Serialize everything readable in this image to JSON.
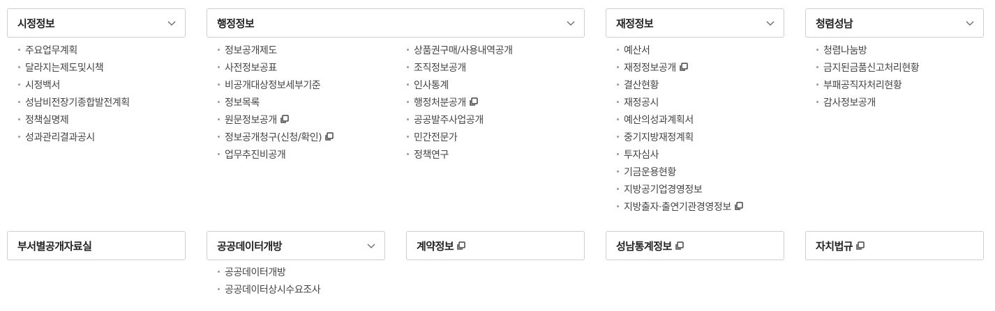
{
  "menus": {
    "city": {
      "title": "시정정보",
      "items": [
        "주요업무계획",
        "달라지는제도및시책",
        "시정백서",
        "성남비전장기종합발전계획",
        "정책실명제",
        "성과관리결과공시"
      ]
    },
    "admin": {
      "title": "행정정보",
      "col1": [
        {
          "label": "정보공개제도",
          "copy": false
        },
        {
          "label": "사전정보공표",
          "copy": false
        },
        {
          "label": "비공개대상정보세부기준",
          "copy": false
        },
        {
          "label": "정보목록",
          "copy": false
        },
        {
          "label": "원문정보공개",
          "copy": true
        },
        {
          "label": "정보공개청구(신청/확인)",
          "copy": true
        },
        {
          "label": "업무추진비공개",
          "copy": false
        }
      ],
      "col2": [
        {
          "label": "상품권구매/사용내역공개",
          "copy": false
        },
        {
          "label": "조직정보공개",
          "copy": false
        },
        {
          "label": "인사통계",
          "copy": false
        },
        {
          "label": "행정처분공개",
          "copy": true
        },
        {
          "label": "공공발주사업공개",
          "copy": false
        },
        {
          "label": "민간전문가",
          "copy": false
        },
        {
          "label": "정책연구",
          "copy": false
        }
      ]
    },
    "finance": {
      "title": "재정정보",
      "items": [
        {
          "label": "예산서",
          "copy": false
        },
        {
          "label": "재정정보공개",
          "copy": true
        },
        {
          "label": "결산현황",
          "copy": false
        },
        {
          "label": "재정공시",
          "copy": false
        },
        {
          "label": "예산의성과계획서",
          "copy": false
        },
        {
          "label": "중기지방재정계획",
          "copy": false
        },
        {
          "label": "투자심사",
          "copy": false
        },
        {
          "label": "기금운용현황",
          "copy": false
        },
        {
          "label": "지방공기업경영정보",
          "copy": false
        },
        {
          "label": "지방출자·출연기관경영정보",
          "copy": true
        }
      ]
    },
    "integrity": {
      "title": "청렴성남",
      "items": [
        "청렴나눔방",
        "금지된금품신고처리현황",
        "부패공직자처리현황",
        "감사정보공개"
      ]
    },
    "dept": {
      "title": "부서별공개자료실"
    },
    "opendata": {
      "title": "공공데이터개방",
      "items": [
        "공공데이터개방",
        "공공데이터상시수요조사"
      ]
    },
    "contract": {
      "title": "계약정보"
    },
    "stats": {
      "title": "성남통계정보"
    },
    "law": {
      "title": "자치법규"
    }
  },
  "icons": {
    "chevron": "chevron-down-icon",
    "copy": "external-link-copy-icon"
  },
  "colors": {
    "border": "#cfcfcf",
    "text": "#444444",
    "title": "#222222",
    "bullet": "#999999"
  }
}
